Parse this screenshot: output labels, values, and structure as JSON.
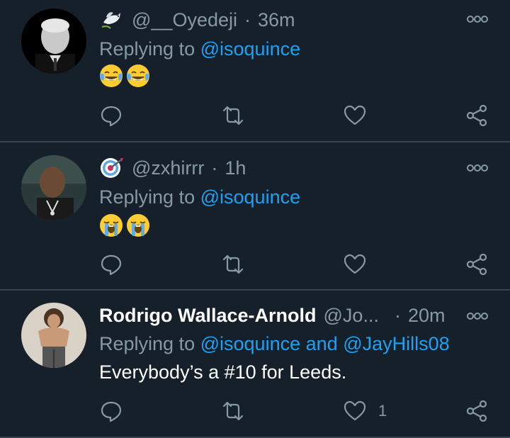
{
  "tweets": [
    {
      "handle": "@__Oyedeji",
      "time": "36m",
      "replying_label": "Replying to",
      "mentions": [
        "@isoquince"
      ],
      "emoji": [
        "😂",
        "😂"
      ],
      "emoji_name": "face-with-tears-of-joy",
      "badge_icon": "dove-icon",
      "likes": ""
    },
    {
      "handle": "@zxhirrr",
      "time": "1h",
      "replying_label": "Replying to",
      "mentions": [
        "@isoquince"
      ],
      "emoji": [
        "😭",
        "😭"
      ],
      "emoji_name": "loudly-crying-face",
      "badge_icon": "target-icon",
      "likes": ""
    },
    {
      "name": "Rodrigo Wallace-Arnold",
      "handle": "@Jo...",
      "time": "20m",
      "replying_label": "Replying to",
      "mention_1": "@isoquince",
      "and_word": "and",
      "mention_2": "@JayHills08",
      "text": "Everybody’s a #10 for Leeds.",
      "likes": "1"
    }
  ],
  "colors": {
    "background": "#15202b",
    "divider": "#38444d",
    "muted": "#8899a6",
    "accent": "#1da1f2"
  },
  "icons": [
    "reply-icon",
    "retweet-icon",
    "like-icon",
    "share-icon",
    "more-icon"
  ]
}
